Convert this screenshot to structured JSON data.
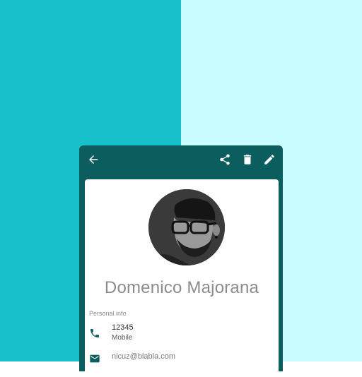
{
  "background": {
    "left_color": "#17c1cc",
    "right_color": "#c8fcff"
  },
  "toolbar": {
    "color": "#0b5d5e",
    "icons": [
      "arrow-back-icon",
      "share-icon",
      "delete-icon",
      "edit-icon"
    ]
  },
  "profile": {
    "name": "Domenico Majorana",
    "avatar": "avatar-photo"
  },
  "personal_info": {
    "section_label": "Personal info",
    "phone": {
      "number": "12345",
      "type": "Mobile",
      "icon": "phone-icon"
    },
    "email": {
      "address": "nicuz@blabla.com",
      "icon": "email-icon"
    }
  }
}
